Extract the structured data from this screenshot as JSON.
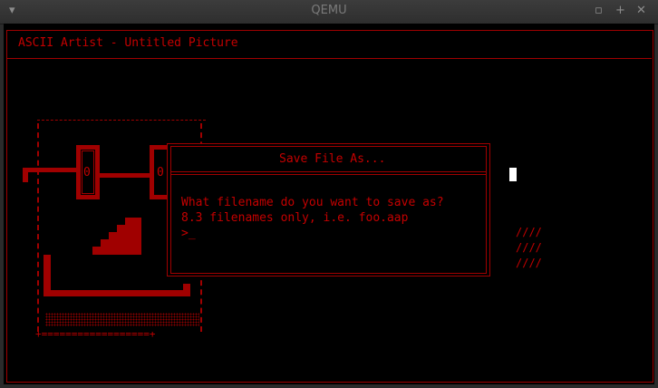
{
  "window": {
    "title": "QEMU",
    "menu_glyph": "▾",
    "min_glyph": "▫",
    "max_glyph": "+",
    "close_glyph": "✕"
  },
  "app": {
    "header": "ASCII Artist - Untitled Picture"
  },
  "canvas_art": {
    "gate_label_1": "0",
    "gate_label_2": "0",
    "bottom_border": "+==================+",
    "slashes": [
      "////",
      "////",
      "////"
    ]
  },
  "dialog": {
    "title": "Save File As...",
    "line1": "What filename do you want to save as?",
    "line2": "8.3 filenames only, i.e. foo.aap",
    "prompt": ">_"
  },
  "colors": {
    "accent": "#c30000",
    "background": "#000000"
  }
}
